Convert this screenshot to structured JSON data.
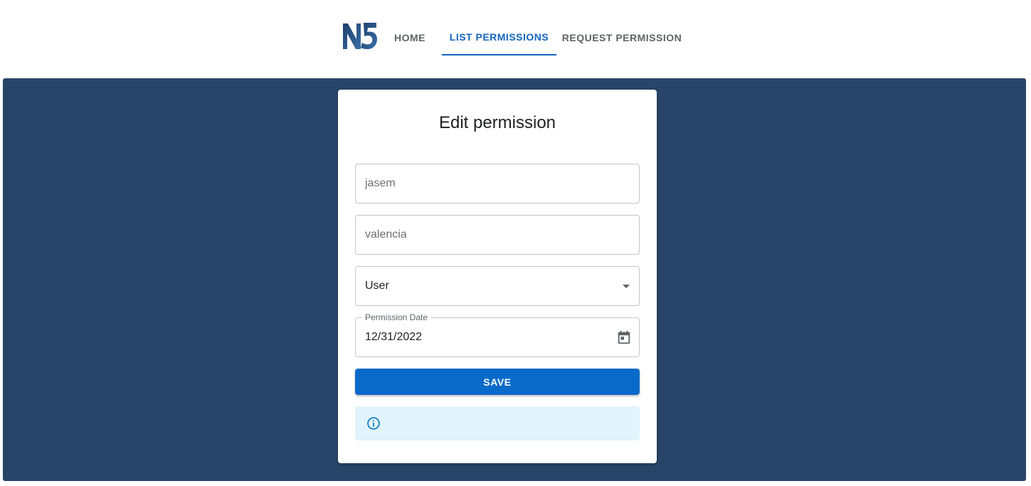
{
  "nav": {
    "logo_text": "N5",
    "tabs": [
      {
        "label": "HOME",
        "active": false
      },
      {
        "label": "LIST PERMISSIONS",
        "active": true
      },
      {
        "label": "REQUEST PERMISSION",
        "active": false
      }
    ]
  },
  "form": {
    "title": "Edit permission",
    "first_name": {
      "placeholder": "jasem",
      "value": ""
    },
    "last_name": {
      "placeholder": "valencia",
      "value": ""
    },
    "permission_type": {
      "selected": "User"
    },
    "permission_date": {
      "label": "Permission Date",
      "value": "12/31/2022"
    },
    "save_label": "SAVE",
    "alert_message": ""
  },
  "colors": {
    "brand_dark": "#284569",
    "accent": "#1565c0",
    "button": "#0a6ac9",
    "alert_bg": "#e1f3fc",
    "info": "#0277bd"
  },
  "icons": [
    "n5-logo",
    "chevron-down-icon",
    "calendar-icon",
    "info-icon"
  ]
}
